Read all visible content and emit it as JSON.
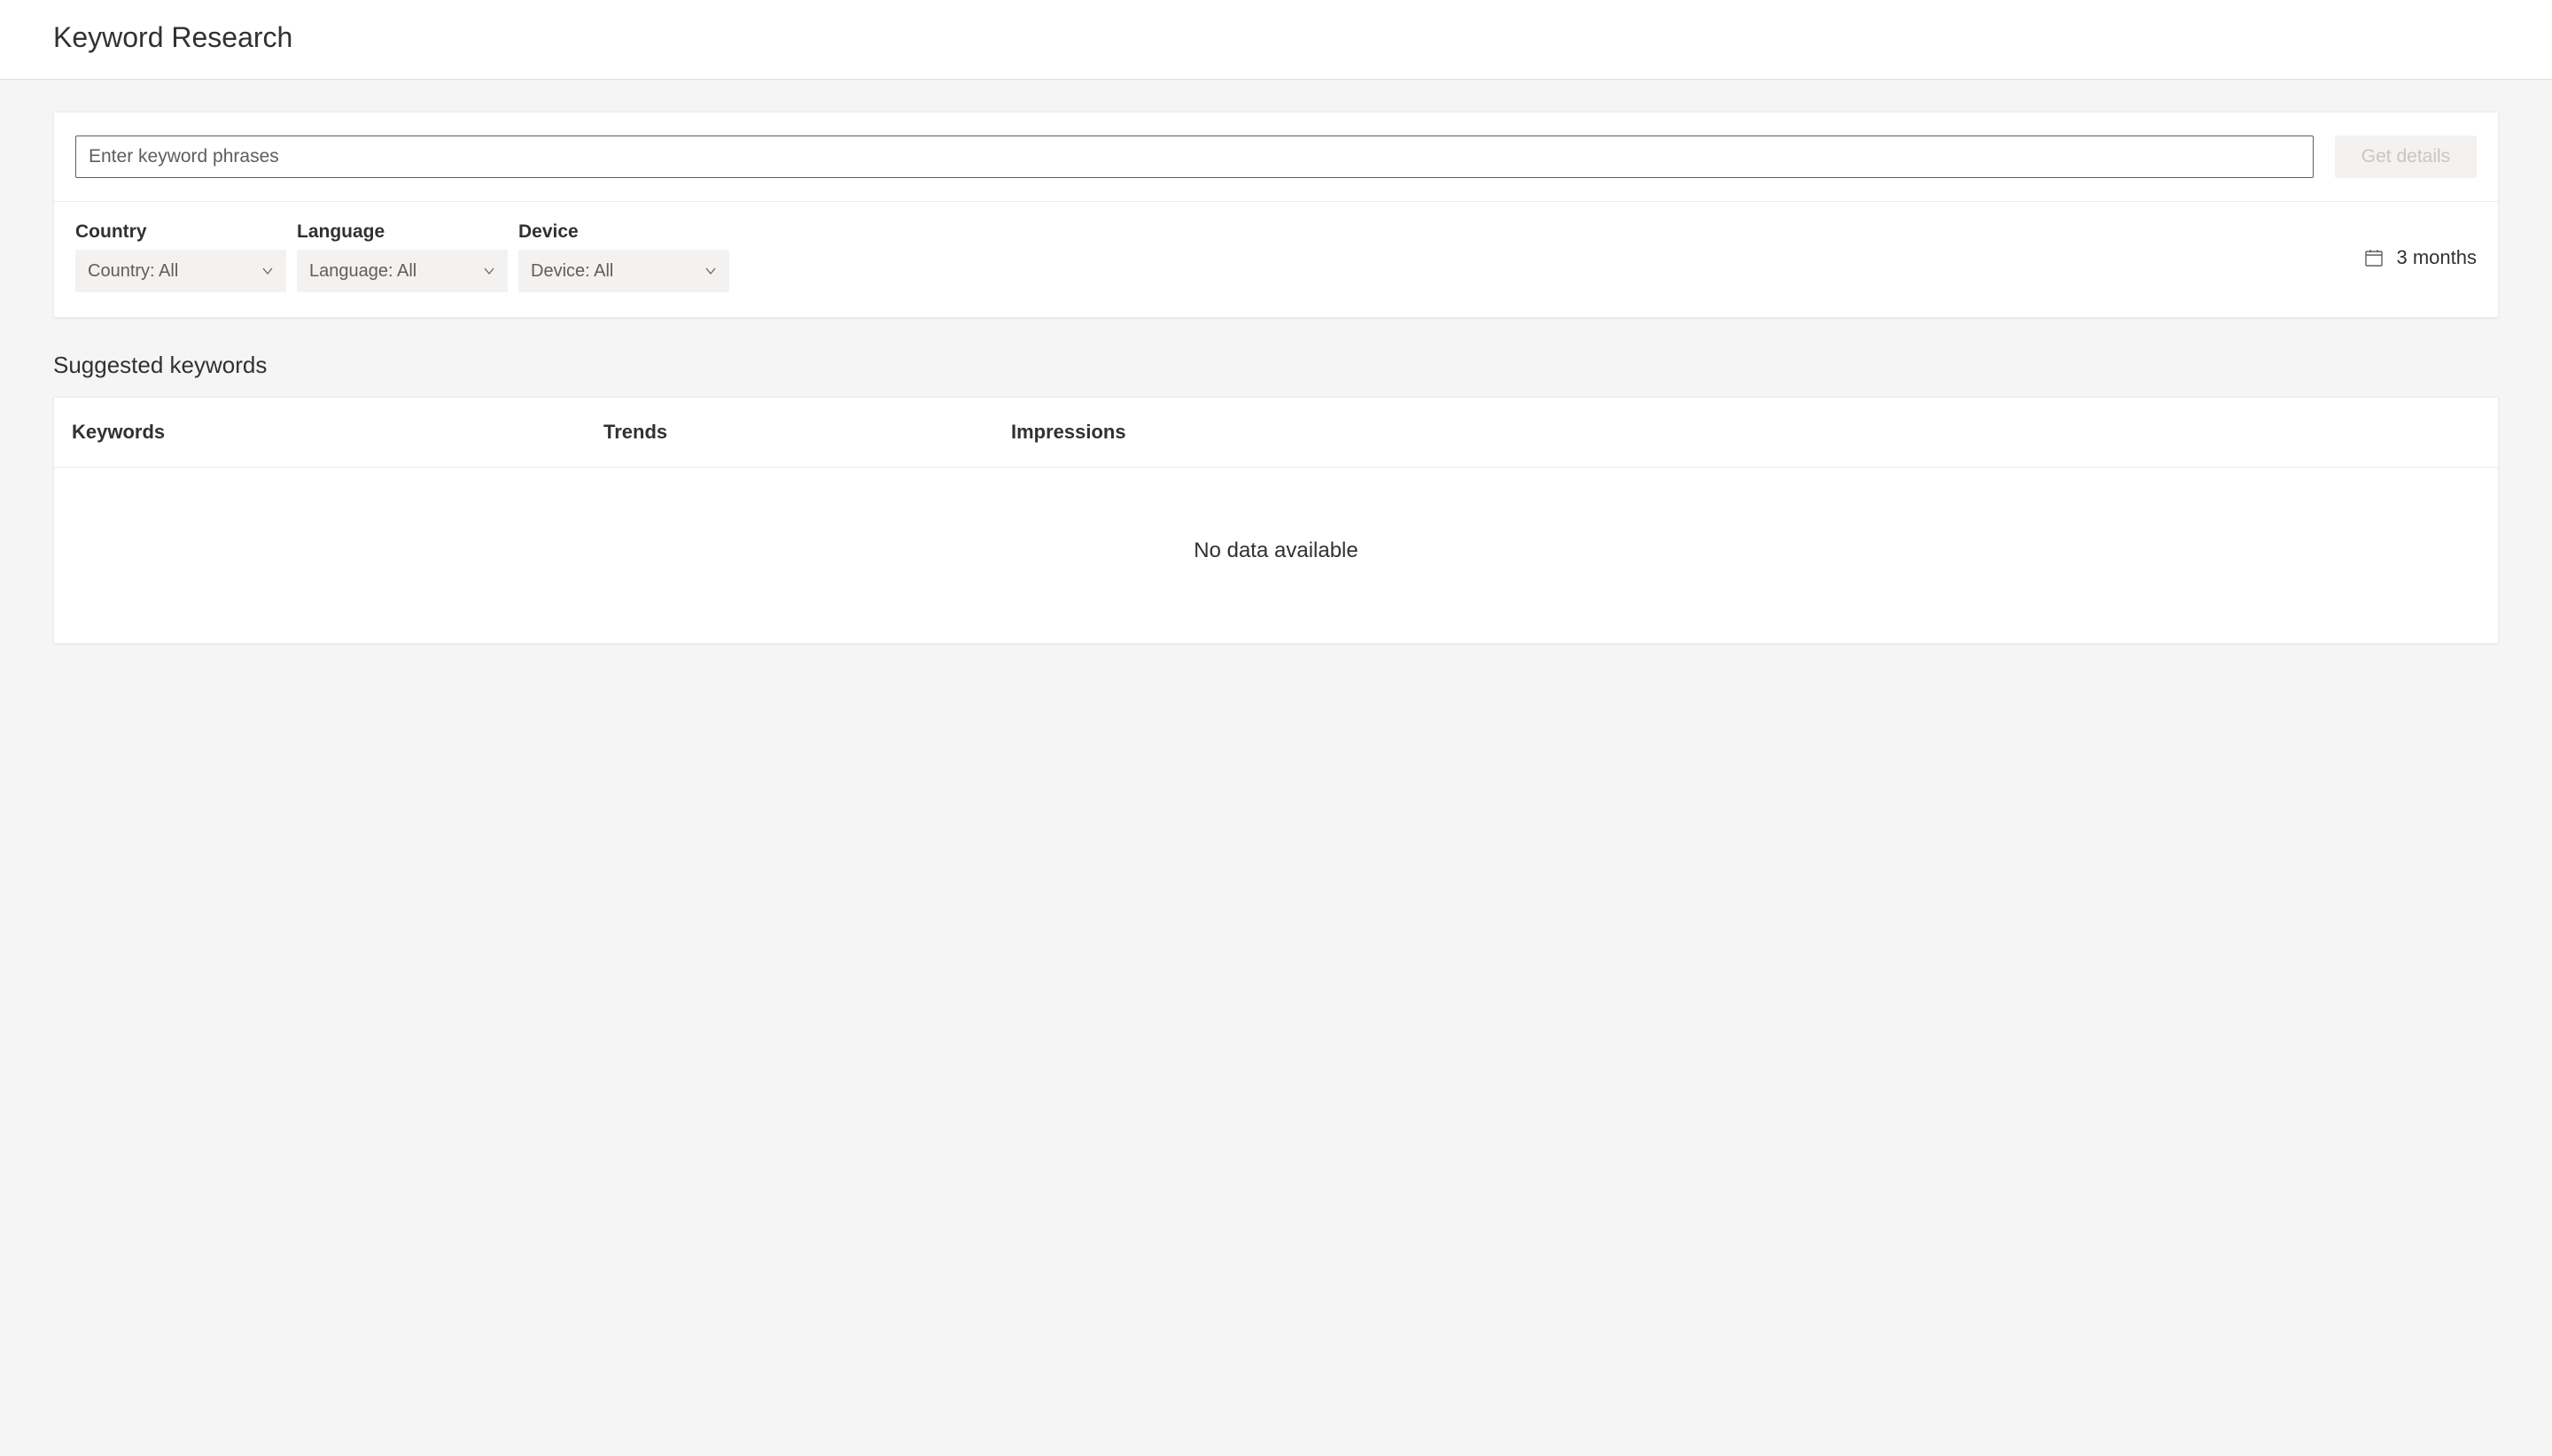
{
  "header": {
    "title": "Keyword Research"
  },
  "search": {
    "placeholder": "Enter keyword phrases",
    "button_label": "Get details"
  },
  "filters": {
    "country": {
      "label": "Country",
      "selected": "Country: All"
    },
    "language": {
      "label": "Language",
      "selected": "Language: All"
    },
    "device": {
      "label": "Device",
      "selected": "Device: All"
    },
    "date_range": "3 months"
  },
  "results": {
    "section_title": "Suggested keywords",
    "columns": {
      "keywords": "Keywords",
      "trends": "Trends",
      "impressions": "Impressions"
    },
    "empty_message": "No data available"
  }
}
